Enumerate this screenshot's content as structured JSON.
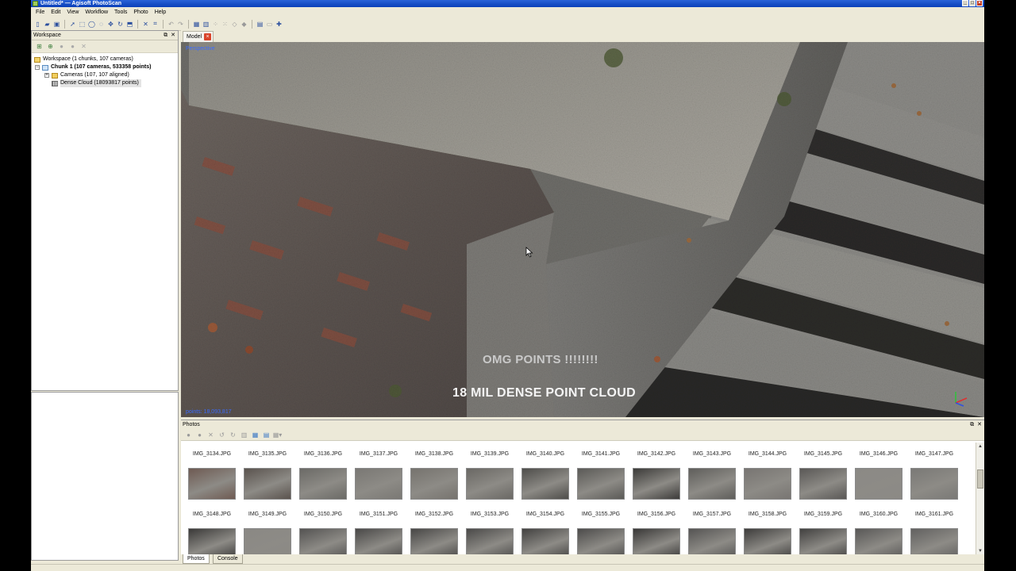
{
  "window": {
    "title": "Untitled* — Agisoft PhotoScan"
  },
  "menu": [
    "File",
    "Edit",
    "View",
    "Workflow",
    "Tools",
    "Photo",
    "Help"
  ],
  "workspace": {
    "header": "Workspace",
    "tree": {
      "root": "Workspace (1 chunks, 107 cameras)",
      "chunk": "Chunk 1 (107 cameras, 533358 points)",
      "cameras": "Cameras (107, 107 aligned)",
      "dense_cloud": "Dense Cloud (18093817 points)"
    }
  },
  "model": {
    "tab_label": "Model",
    "viewport": {
      "projection": "Perspective",
      "points": "points: 18,093,817",
      "caption_top": "OMG POINTS !!!!!!!!",
      "caption_main": "18 MIL  DENSE POINT CLOUD"
    }
  },
  "photos": {
    "header": "Photos",
    "row1": [
      "IMG_3134.JPG",
      "IMG_3135.JPG",
      "IMG_3136.JPG",
      "IMG_3137.JPG",
      "IMG_3138.JPG",
      "IMG_3139.JPG",
      "IMG_3140.JPG",
      "IMG_3141.JPG",
      "IMG_3142.JPG",
      "IMG_3143.JPG",
      "IMG_3144.JPG",
      "IMG_3145.JPG",
      "IMG_3146.JPG",
      "IMG_3147.JPG"
    ],
    "row2": [
      "IMG_3148.JPG",
      "IMG_3149.JPG",
      "IMG_3150.JPG",
      "IMG_3151.JPG",
      "IMG_3152.JPG",
      "IMG_3153.JPG",
      "IMG_3154.JPG",
      "IMG_3155.JPG",
      "IMG_3156.JPG",
      "IMG_3157.JPG",
      "IMG_3158.JPG",
      "IMG_3159.JPG",
      "IMG_3160.JPG",
      "IMG_3161.JPG"
    ]
  },
  "bottom_tabs": {
    "photos": "Photos",
    "console": "Console"
  },
  "colors": {
    "titlebar": "#0a3fb8",
    "chrome": "#ece9d8",
    "annotation_blue": "#3b6cff"
  }
}
